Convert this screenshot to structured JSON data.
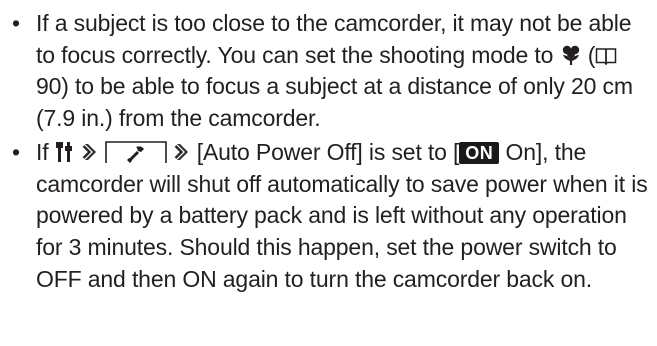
{
  "bullets": [
    {
      "seg1": "If a subject is too close to the camcorder, it may not be able to focus correctly. You can set the shooting mode to",
      "seg2": "(",
      "seg3": "90) to be able to focus a subject at a distance of only 20 cm (7.9 in.) from the camcorder."
    },
    {
      "seg1": "If",
      "seg2": "[Auto Power Off] is set to [",
      "badge": "ON",
      "seg3": "On], the camcorder will shut off automatically to save power when it is powered by a battery pack and is left without any operation for 3 minutes. Should this happen, set the power switch to OFF and then ON again to turn the camcorder back on."
    }
  ],
  "icons": {
    "macro": "macro-flower-icon",
    "reference": "book-icon",
    "setup_menu": "tools-menu-icon",
    "arrow": "arrow-right-icon",
    "tab": "setup-tab-icon"
  },
  "colors": {
    "text": "#231f20",
    "arrow": "#2b2b2b",
    "badge_bg": "#1a1a1a",
    "badge_fg": "#ffffff"
  }
}
